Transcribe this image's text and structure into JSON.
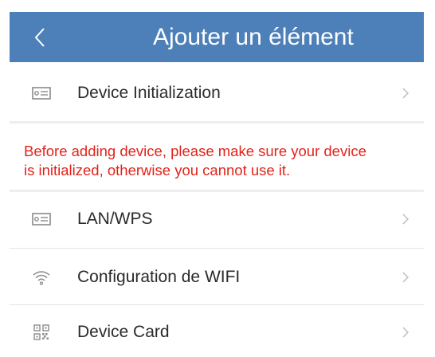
{
  "header": {
    "title": "Ajouter un élément",
    "back_icon": "chevron-left-icon"
  },
  "rows": [
    {
      "label": "Device Initialization",
      "icon": "device-icon"
    },
    {
      "label": "LAN/WPS",
      "icon": "device-icon"
    },
    {
      "label": "Configuration de WIFI",
      "icon": "wifi-icon"
    },
    {
      "label": "Device Card",
      "icon": "qr-code-icon"
    }
  ],
  "warning": {
    "line1": "Before adding device, please make sure your device",
    "line2": "is initialized, otherwise you cannot use it."
  },
  "colors": {
    "header_bg": "#4d80b8",
    "warning_text": "#e2231a",
    "icon": "#8a8a8a",
    "chevron": "#bdbdbd"
  }
}
